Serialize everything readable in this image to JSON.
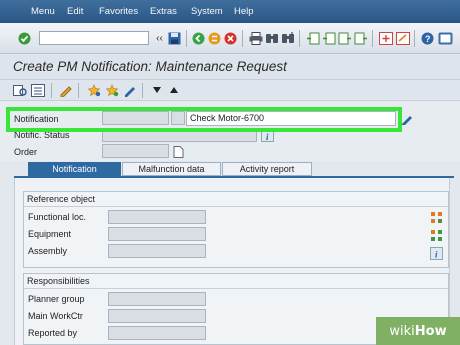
{
  "menu": {
    "items": [
      {
        "label": "Menu"
      },
      {
        "label": "Edit"
      },
      {
        "label": "Favorites"
      },
      {
        "label": "Extras"
      },
      {
        "label": "System"
      },
      {
        "label": "Help"
      }
    ]
  },
  "toolbar": {
    "command_field_value": "",
    "back_chevrons": "‹‹"
  },
  "title": "Create PM Notification: Maintenance Request",
  "header": {
    "notification_label": "Notification",
    "notification_number": "",
    "notification_short_text": "Check Motor-6700",
    "notif_status_label": "Notific. Status",
    "order_label": "Order"
  },
  "tabs": [
    {
      "label": "Notification",
      "active": true
    },
    {
      "label": "Malfunction data",
      "active": false
    },
    {
      "label": "Activity report",
      "active": false
    }
  ],
  "reference_object": {
    "title": "Reference object",
    "fields": [
      {
        "label": "Functional loc."
      },
      {
        "label": "Equipment"
      },
      {
        "label": "Assembly"
      }
    ]
  },
  "responsibilities": {
    "title": "Responsibilities",
    "fields": [
      {
        "label": "Planner group"
      },
      {
        "label": "Main WorkCtr"
      },
      {
        "label": "Reported by"
      }
    ]
  },
  "watermark": {
    "prefix": "wiki",
    "suffix": "How"
  },
  "colors": {
    "menubar": "#2f5f8f",
    "highlight": "#39e53a",
    "active_tab": "#2e6aa1",
    "watermark": "#7fb063"
  }
}
